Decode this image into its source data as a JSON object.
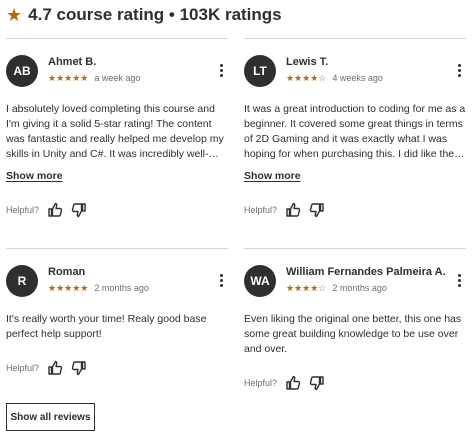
{
  "header": {
    "star_icon": "star-icon",
    "title": "4.7 course rating • 103K ratings"
  },
  "reviews": [
    {
      "initials": "AB",
      "name": "Ahmet B.",
      "stars": "★★★★★",
      "rating": 5,
      "date": "a week ago",
      "text": "I absolutely loved completing this course and I'm giving it a solid 5-star rating! The content was fantastic and really helped me develop my skills in Unity and C#. It was incredibly well-explained, especially for those looking to dive into game development.",
      "show_more": "Show more",
      "helpful_label": "Helpful?"
    },
    {
      "initials": "LT",
      "name": "Lewis T.",
      "stars": "★★★★☆",
      "rating": 4,
      "date": "4 weeks ago",
      "text": "It was a great introduction to coding for me as a beginner. It covered some great things in terms of 2D Gaming and it was exactly what I was hoping for when purchasing this. I did like the structure of it, the Quiz Mania section l...",
      "show_more": "Show more",
      "helpful_label": "Helpful?"
    },
    {
      "initials": "R",
      "name": "Roman",
      "stars": "★★★★★",
      "rating": 5,
      "date": "2 months ago",
      "text": "It's really worth your time! Realy good base perfect help support!",
      "helpful_label": "Helpful?"
    },
    {
      "initials": "WA",
      "name": "William Fernandes Palmeira A.",
      "stars": "★★★★☆",
      "rating": 4,
      "date": "2 months ago",
      "text": "Even liking the original one better, this one has some great building knowledge to be use over and over.",
      "helpful_label": "Helpful?"
    }
  ],
  "show_all_label": "Show all reviews",
  "colors": {
    "star": "#b4690e",
    "text": "#2d2f31",
    "muted": "#6a6f73",
    "divider": "#d1d7dc"
  }
}
